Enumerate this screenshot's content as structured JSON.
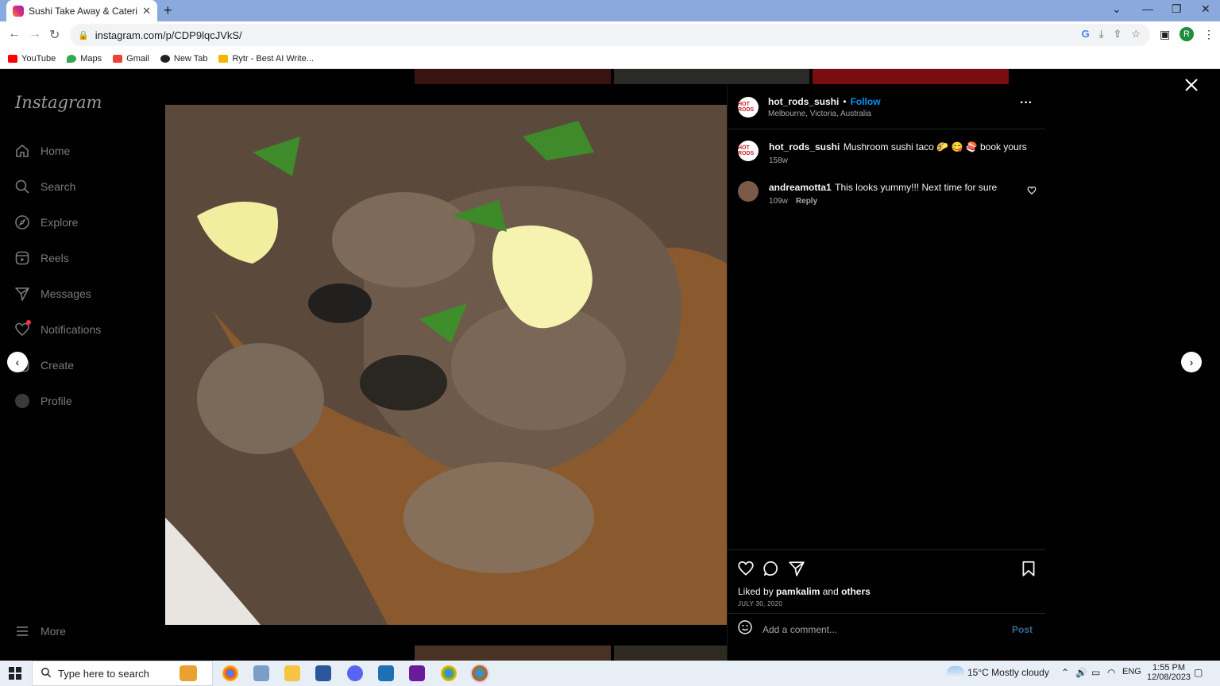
{
  "browser": {
    "tab_title": "Sushi Take Away & Catering (@h",
    "url": "instagram.com/p/CDP9lqcJVkS/",
    "profile_initial": "R",
    "bookmarks": [
      {
        "label": "YouTube",
        "color": "#ff0000"
      },
      {
        "label": "Maps",
        "color": "#34a853"
      },
      {
        "label": "Gmail",
        "color": "#ea4335"
      },
      {
        "label": "New Tab",
        "color": "#202124"
      },
      {
        "label": "Rytr - Best AI Write...",
        "color": "#f4b400"
      }
    ]
  },
  "instagram": {
    "logo": "Instagram",
    "nav": [
      {
        "label": "Home",
        "icon": "home-icon"
      },
      {
        "label": "Search",
        "icon": "search-icon"
      },
      {
        "label": "Explore",
        "icon": "compass-icon"
      },
      {
        "label": "Reels",
        "icon": "reels-icon"
      },
      {
        "label": "Messages",
        "icon": "send-icon"
      },
      {
        "label": "Notifications",
        "icon": "heart-icon"
      },
      {
        "label": "Create",
        "icon": "plus-icon"
      },
      {
        "label": "Profile",
        "icon": "avatar-icon"
      }
    ],
    "more_label": "More"
  },
  "post": {
    "username": "hot_rods_sushi",
    "follow_label": "Follow",
    "location": "Melbourne, Victoria, Australia",
    "avatar_text": "HOT RODS",
    "caption_user": "hot_rods_sushi",
    "caption_text": "Mushroom sushi taco 🌮 😋 🍣 book yours",
    "caption_age": "158w",
    "comments": [
      {
        "user": "andreamotta1",
        "text": "This looks yummy!!! Next time for sure",
        "age": "109w",
        "reply_label": "Reply"
      }
    ],
    "liked_by_prefix": "Liked by",
    "liked_by_user": "pamkalim",
    "liked_by_and": "and",
    "liked_by_others": "others",
    "date": "JULY 30, 2020",
    "add_comment_placeholder": "Add a comment...",
    "post_button": "Post"
  },
  "taskbar": {
    "search_placeholder": "Type here to search",
    "weather": "15°C  Mostly cloudy",
    "language": "ENG",
    "time": "1:55 PM",
    "date": "12/08/2023"
  }
}
